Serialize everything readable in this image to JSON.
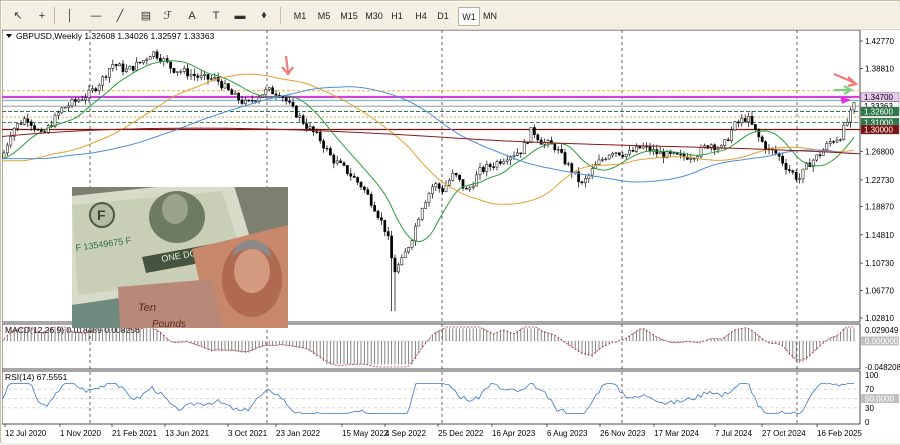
{
  "toolbar": {
    "tools": [
      {
        "name": "cursor",
        "glyph": "↖"
      },
      {
        "name": "crosshair",
        "glyph": "+"
      },
      {
        "name": "vertical-line",
        "glyph": "│"
      },
      {
        "name": "horizontal-line",
        "glyph": "—"
      },
      {
        "name": "trendline",
        "glyph": "╱"
      },
      {
        "name": "channel",
        "glyph": "▤"
      },
      {
        "name": "fibonacci",
        "glyph": "ℱ"
      },
      {
        "name": "text",
        "glyph": "A"
      },
      {
        "name": "label",
        "glyph": "T"
      },
      {
        "name": "rectangle",
        "glyph": "▬"
      },
      {
        "name": "shapes",
        "glyph": "⬧"
      }
    ],
    "timeframes": [
      "M1",
      "M5",
      "M15",
      "M30",
      "H1",
      "H4",
      "D1",
      "W1",
      "MN"
    ],
    "active_timeframe": "W1"
  },
  "main_chart": {
    "header": "GBPUSD,Weekly  1.32608 1.34026 1.32597 1.33363",
    "price_ticks": [
      "1.42770",
      "1.38810",
      "1.34700",
      "1.32600",
      "1.31000",
      "1.30000",
      "1.26800",
      "1.22730",
      "1.18870",
      "1.14810",
      "1.10730",
      "1.06770",
      "1.02810"
    ],
    "level_labels": [
      {
        "text": "1.34700",
        "bg": "#e8c8f0"
      },
      {
        "text": "1.33363",
        "bg": "#ffffff"
      },
      {
        "text": "1.32600",
        "bg": "#2e7b4a"
      },
      {
        "text": "1.31000",
        "bg": "#2e7b4a"
      },
      {
        "text": "1.30000",
        "bg": "#7a1212"
      }
    ]
  },
  "macd": {
    "label": "MACD(12,26,9) 0.018489 0.008256",
    "ticks": [
      "0.029049",
      "0.000000",
      "-0.048208"
    ]
  },
  "rsi": {
    "label": "RSI(14) 67.5551",
    "ticks": [
      "100",
      "70",
      "50.0000",
      "30",
      "0"
    ]
  },
  "time_axis": [
    "12 Jul 2020",
    "1 Nov 2020",
    "21 Feb 2021",
    "13 Jun 2021",
    "3 Oct 2021",
    "23 Jan 2022",
    "15 May 2022",
    "4 Sep 2022",
    "25 Dec 2022",
    "16 Apr 2023",
    "6 Aug 2023",
    "26 Nov 2023",
    "17 Mar 2024",
    "7 Jul 2024",
    "27 Oct 2024",
    "16 Feb 2025"
  ],
  "colors": {
    "bull": "#000000",
    "bear": "#000000",
    "ma_fast": "#2a9d3a",
    "ma_mid": "#e3a030",
    "ma_slow": "#4d8fd8",
    "ma_long": "#8b1a1a",
    "arrow": "#f07a7a"
  }
}
